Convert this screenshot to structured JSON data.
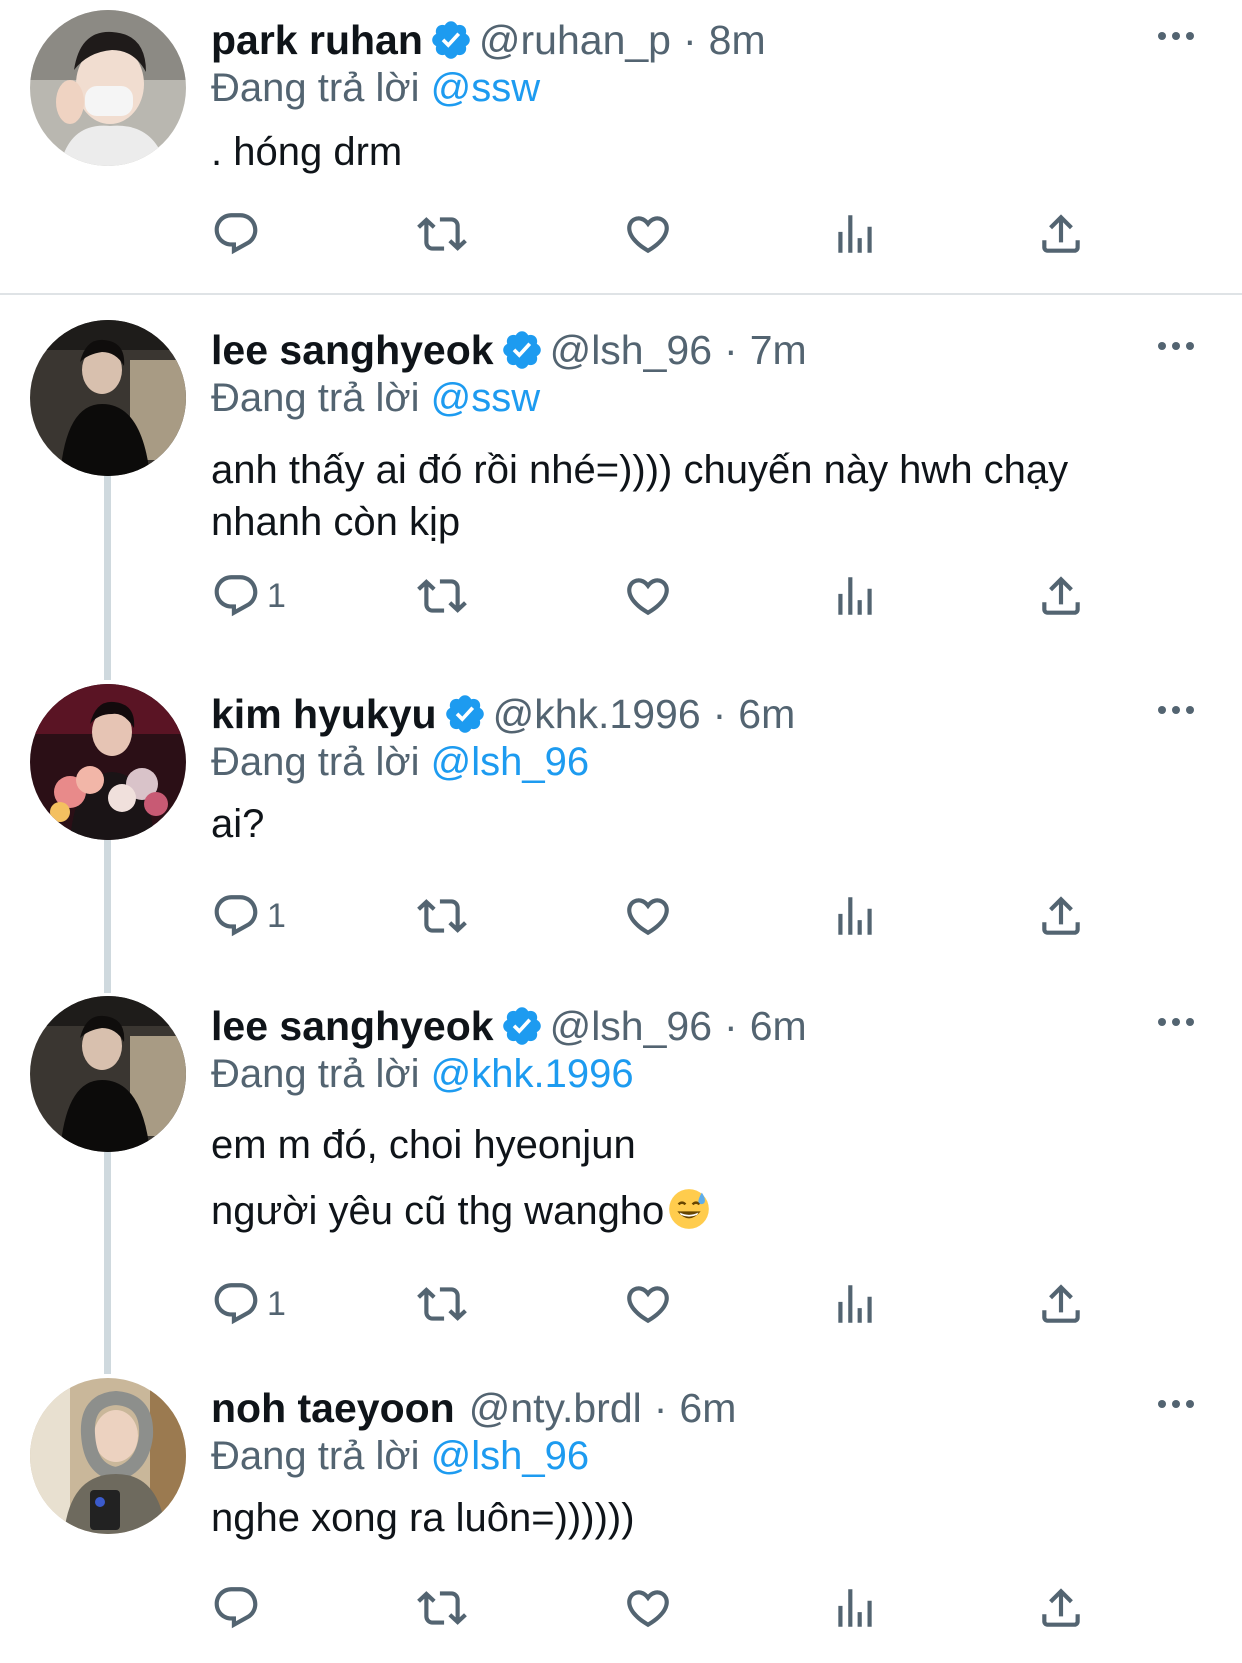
{
  "reply_prefix": "Đang trả lời",
  "dot": "·",
  "colors": {
    "link": "#1d9bf0",
    "secondary": "#536471",
    "verified": "#1d9bf0",
    "divider": "#dfe3e6"
  },
  "icons": [
    "reply-icon",
    "retweet-icon",
    "like-icon",
    "views-icon",
    "share-icon",
    "verified-badge-icon",
    "more-icon",
    "sweat-smile-emoji"
  ],
  "tweets": [
    {
      "name": "park ruhan",
      "verified": true,
      "handle": "@ruhan_p",
      "time": "8m",
      "reply_to": "@ssw",
      "lines": [
        ". hóng drm"
      ],
      "reply_count": ""
    },
    {
      "name": "lee sanghyeok",
      "verified": true,
      "handle": "@lsh_96",
      "time": "7m",
      "reply_to": "@ssw",
      "lines": [
        "anh thấy ai đó rồi nhé=)))) chuyến này hwh chạy",
        "nhanh còn kịp"
      ],
      "reply_count": "1"
    },
    {
      "name": "kim hyukyu",
      "verified": true,
      "handle": "@khk.1996",
      "time": "6m",
      "reply_to": "@lsh_96",
      "lines": [
        "ai?"
      ],
      "reply_count": "1"
    },
    {
      "name": "lee sanghyeok",
      "verified": true,
      "handle": "@lsh_96",
      "time": "6m",
      "reply_to": "@khk.1996",
      "lines": [
        "em m đó, choi hyeonjun",
        "người yêu cũ thg wangho"
      ],
      "reply_count": "1"
    },
    {
      "name": "noh taeyoon",
      "verified": false,
      "handle": "@nty.brdl",
      "time": "6m",
      "reply_to": "@lsh_96",
      "lines": [
        "nghe xong ra luôn=))))))"
      ],
      "reply_count": ""
    }
  ]
}
